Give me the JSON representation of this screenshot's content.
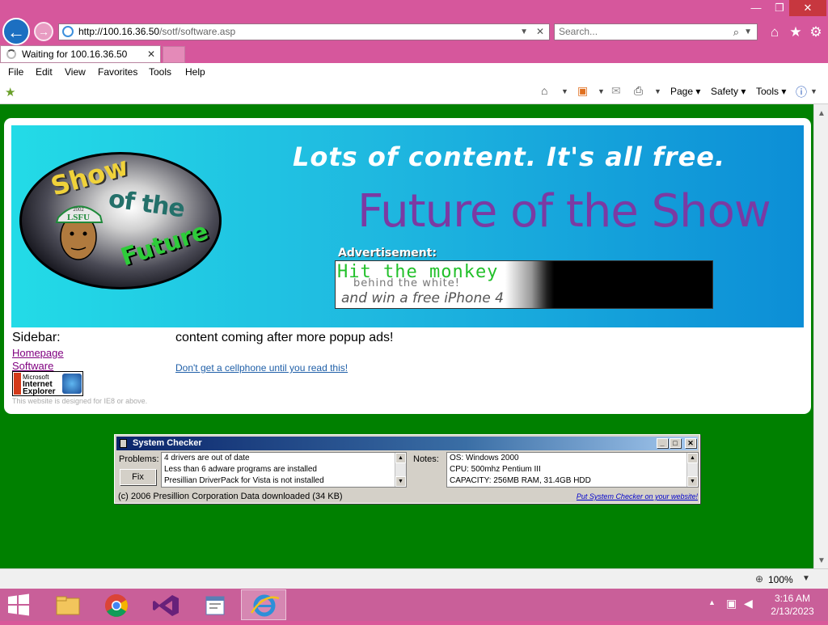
{
  "browser": {
    "url_host": "http://100.16.36.50",
    "url_path": "/sotf/software.asp",
    "search_placeholder": "Search...",
    "tab_label": "Waiting for 100.16.36.50",
    "menu": [
      "File",
      "Edit",
      "View",
      "Favorites",
      "Tools",
      "Help"
    ],
    "command_bar": {
      "page": "Page",
      "safety": "Safety",
      "tools": "Tools"
    },
    "zoom": "100%"
  },
  "page": {
    "banner": {
      "logo_show": "Show",
      "logo_ofthe": "of the",
      "logo_future": "Future",
      "logo_cap_year": "2002",
      "logo_cap_text": "LSFU",
      "tagline": "Lots of content. It's all free.",
      "title": "Future of the Show",
      "ad_label": "Advertisement:",
      "ad_line1": "Hit the monkey",
      "ad_line2": "behind the white!",
      "ad_line3": "and win a free iPhone 4"
    },
    "sidebar": {
      "title": "Sidebar:",
      "links": [
        "Homepage",
        "Software"
      ],
      "ie_badge": {
        "line1": "Microsoft",
        "line2": "Internet",
        "line3": "Explorer",
        "strip": "FREE"
      },
      "note": "This website is designed for IE8 or above."
    },
    "main": {
      "text": "content coming after more popup ads!",
      "link": "Don't get a cellphone until you read this!"
    },
    "system_checker": {
      "title": "System Checker",
      "problems_label": "Problems:",
      "fix_label": "Fix",
      "problems": [
        "4 drivers are out of date",
        "Less than 6 adware programs are installed",
        "Presillian DriverPack for Vista is not installed"
      ],
      "notes_label": "Notes:",
      "notes": [
        "OS: Windows 2000",
        "CPU: 500mhz Pentium III",
        "CAPACITY: 256MB RAM, 31.4GB HDD"
      ],
      "footer": "(c) 2006 Presillion Corporation  Data downloaded (34 KB)",
      "link": "Put System Checker on your website!"
    }
  },
  "taskbar": {
    "time": "3:16 AM",
    "date": "2/13/2023",
    "apps": [
      "file-explorer",
      "chrome",
      "visual-studio",
      "app-window",
      "internet-explorer"
    ]
  },
  "colors": {
    "titlebar": "#d6579c",
    "page_background": "#008000",
    "banner_title": "#7b3aa3",
    "visited_link": "#800080",
    "link": "#1f5fa8"
  }
}
